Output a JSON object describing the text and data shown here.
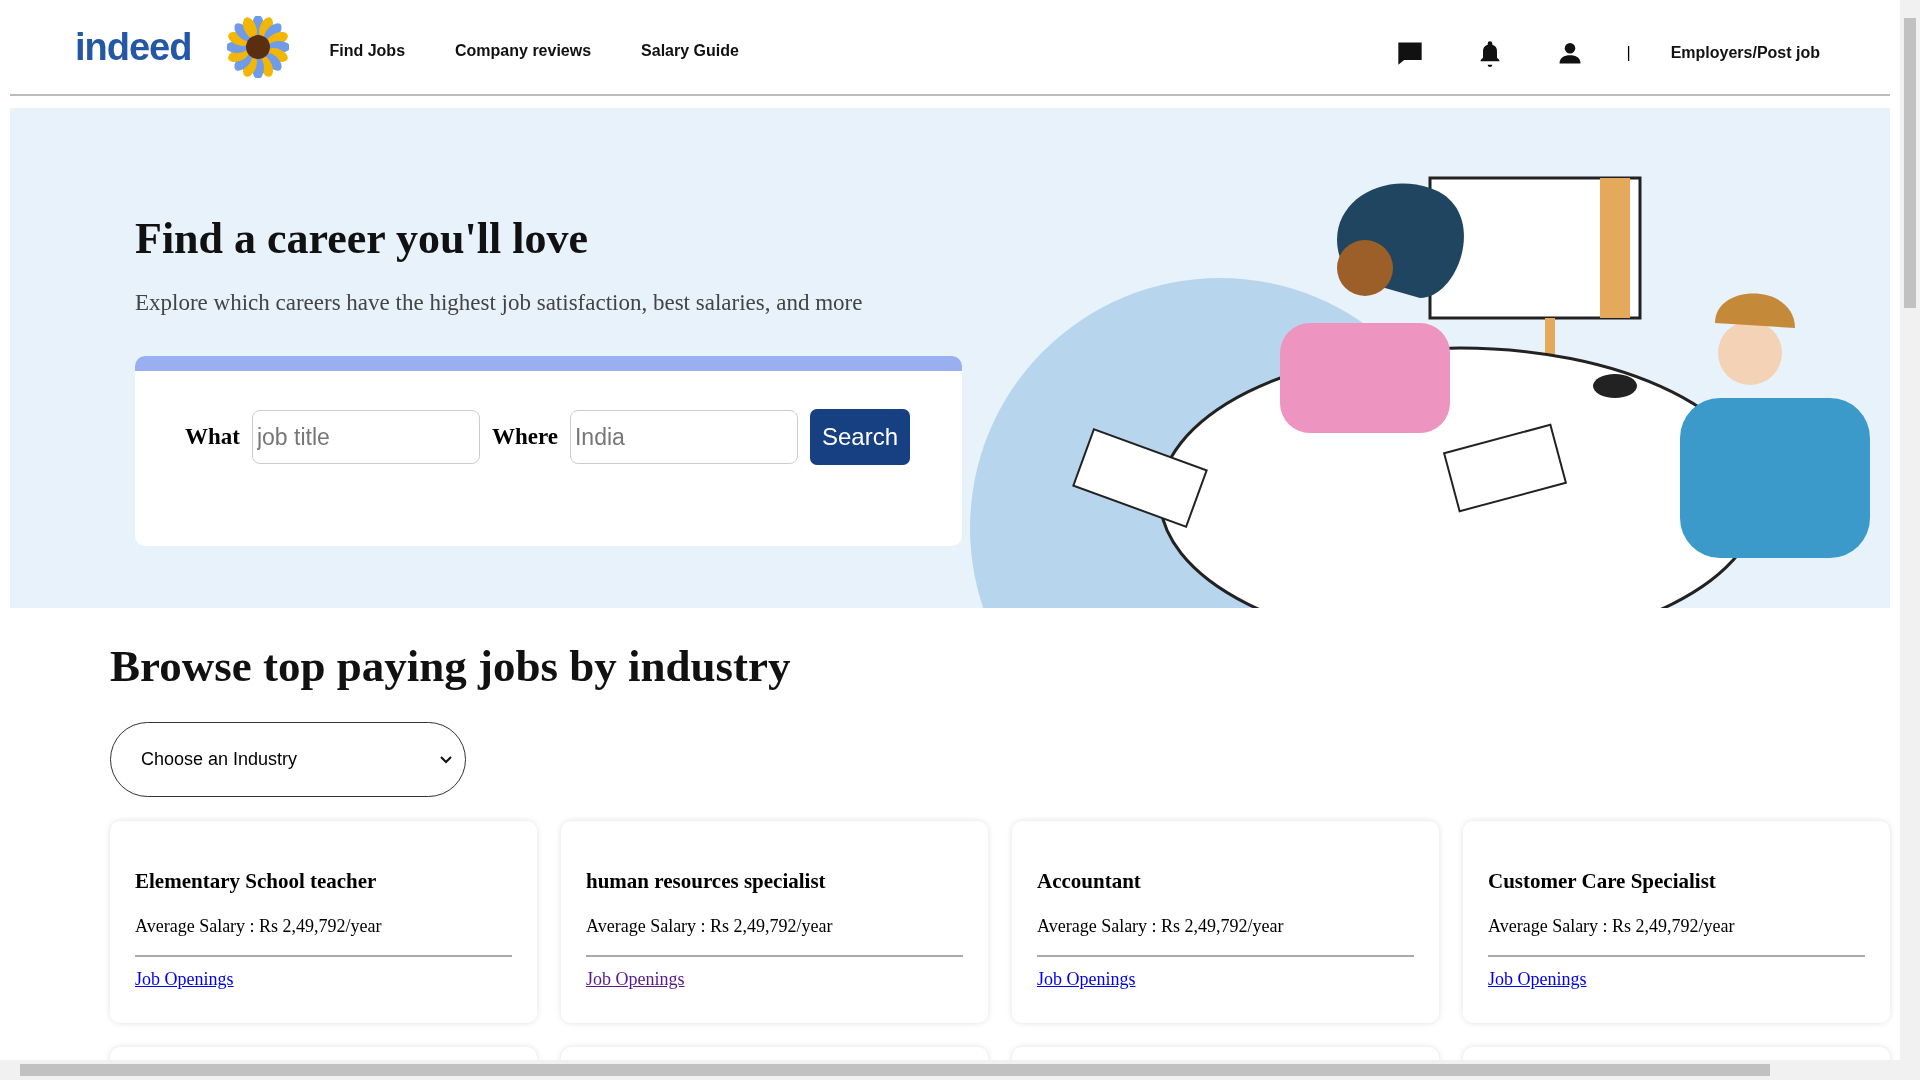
{
  "header": {
    "logo": "indeed",
    "nav": [
      {
        "label": "Find Jobs"
      },
      {
        "label": "Company reviews"
      },
      {
        "label": "Salary Guide"
      }
    ],
    "separator": "|",
    "employers_link": "Employers/Post job"
  },
  "hero": {
    "title": "Find a career you'll love",
    "subtitle": "Explore which careers have the highest job satisfaction, best salaries, and more",
    "search": {
      "what_label": "What",
      "what_placeholder": "job title",
      "where_label": "Where",
      "where_placeholder": "India",
      "button": "Search"
    }
  },
  "browse": {
    "title": "Browse top paying jobs by industry",
    "dropdown": "Choose an Industry",
    "cards": [
      {
        "title": "Elementary School teacher",
        "salary": "Average Salary : Rs 2,49,792/year",
        "link": "Job Openings",
        "visited": false
      },
      {
        "title": "human resources specialist",
        "salary": "Average Salary : Rs 2,49,792/year",
        "link": "Job Openings",
        "visited": true
      },
      {
        "title": "Accountant",
        "salary": "Average Salary : Rs 2,49,792/year",
        "link": "Job Openings",
        "visited": false
      },
      {
        "title": "Customer Care Specialist",
        "salary": "Average Salary : Rs 2,49,792/year",
        "link": "Job Openings",
        "visited": false
      }
    ]
  }
}
